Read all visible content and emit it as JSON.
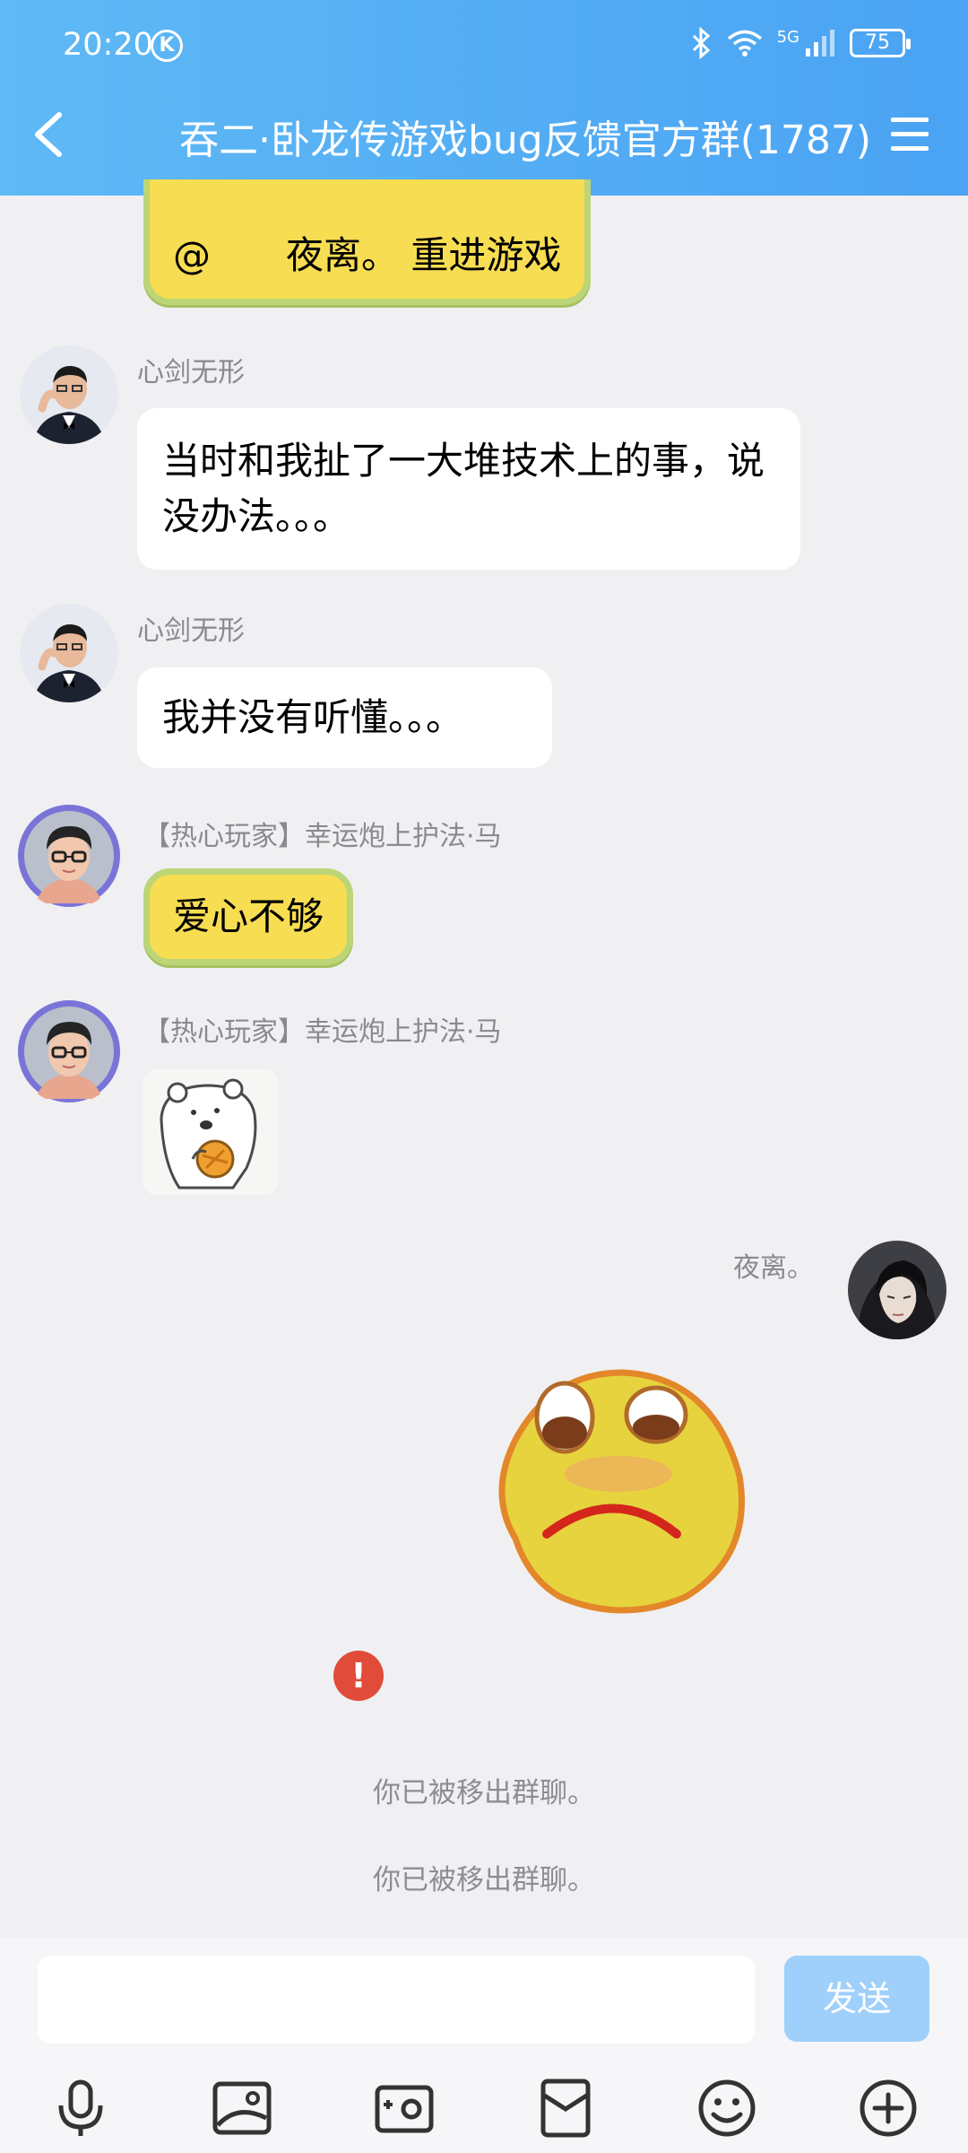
{
  "status_bar": {
    "time": "20:20",
    "battery": "75",
    "network": "5G"
  },
  "header": {
    "title": "吞二·卧龙传游戏bug反馈官方群(1787)"
  },
  "messages": {
    "m0": {
      "text": "@　　夜离。 重进游戏"
    },
    "m1": {
      "sender": "心剑无形",
      "text": "当时和我扯了一大堆技术上的事，说没办法。。。"
    },
    "m2": {
      "sender": "心剑无形",
      "text": "我并没有听懂。。。"
    },
    "m3": {
      "sender": "【热心玩家】幸运炮上护法·马",
      "text": "爱心不够"
    },
    "m4": {
      "sender": "【热心玩家】幸运炮上护法·马"
    },
    "m5": {
      "sender": "夜离。"
    },
    "error": {
      "symbol": "!"
    }
  },
  "system": [
    "你已被移出群聊。",
    "你已被移出群聊。"
  ],
  "input": {
    "placeholder": "",
    "send_label": "发送"
  },
  "toolbar": [
    "microphone-icon",
    "image-icon",
    "camera-icon",
    "red-packet-icon",
    "emoji-icon",
    "plus-icon"
  ],
  "colors": {
    "header": "#4aa3f3",
    "bubble_yellow": "#f7dd52",
    "send_disabled": "#9fd0fb",
    "error": "#e04b3a"
  }
}
